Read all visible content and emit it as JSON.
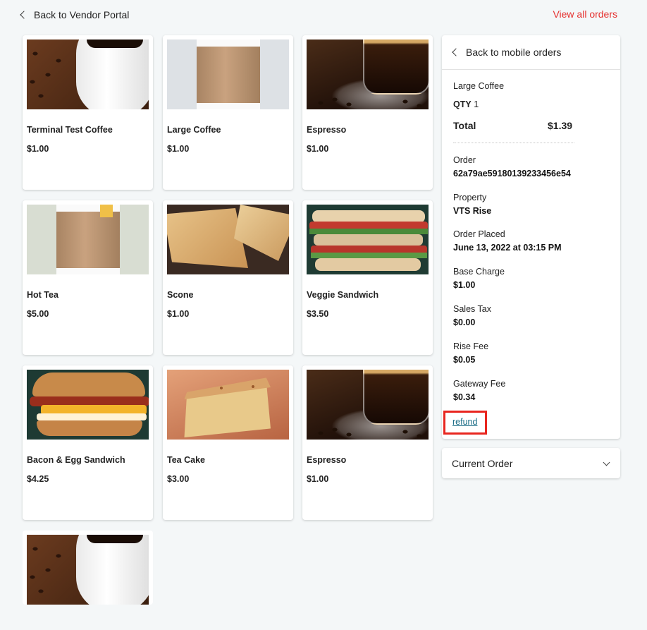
{
  "header": {
    "back_label": "Back to Vendor Portal",
    "view_all_label": "View all orders"
  },
  "products": [
    {
      "name": "Terminal Test Coffee",
      "price": "$1.00",
      "image": "coffee-cup"
    },
    {
      "name": "Large Coffee",
      "price": "$1.00",
      "image": "coffee-sleeve"
    },
    {
      "name": "Espresso",
      "price": "$1.00",
      "image": "espresso"
    },
    {
      "name": "Hot Tea",
      "price": "$5.00",
      "image": "tea-sleeve"
    },
    {
      "name": "Scone",
      "price": "$1.00",
      "image": "scone"
    },
    {
      "name": "Veggie Sandwich",
      "price": "$3.50",
      "image": "sandwich"
    },
    {
      "name": "Bacon & Egg Sandwich",
      "price": "$4.25",
      "image": "bacon-egg"
    },
    {
      "name": "Tea Cake",
      "price": "$3.00",
      "image": "tea-cake"
    },
    {
      "name": "Espresso",
      "price": "$1.00",
      "image": "espresso"
    },
    {
      "name": "",
      "price": "",
      "image": "coffee-cup"
    }
  ],
  "order_detail": {
    "back_label": "Back to mobile orders",
    "item_name": "Large Coffee",
    "qty_label": "QTY",
    "qty_value": "1",
    "total_label": "Total",
    "total_value": "$1.39",
    "fields": [
      {
        "label": "Order",
        "value": "62a79ae59180139233456e54"
      },
      {
        "label": "Property",
        "value": "VTS Rise"
      },
      {
        "label": "Order Placed",
        "value": "June 13, 2022 at 03:15 PM"
      },
      {
        "label": "Base Charge",
        "value": "$1.00"
      },
      {
        "label": "Sales Tax",
        "value": "$0.00"
      },
      {
        "label": "Rise Fee",
        "value": "$0.05"
      },
      {
        "label": "Gateway Fee",
        "value": "$0.34"
      }
    ],
    "refund_label": "refund"
  },
  "current_order": {
    "label": "Current Order"
  },
  "colors": {
    "accent_red": "#e5312f",
    "highlight_box": "#e8261f",
    "link_blue": "#1a6c86",
    "background": "#f4f7f8"
  }
}
